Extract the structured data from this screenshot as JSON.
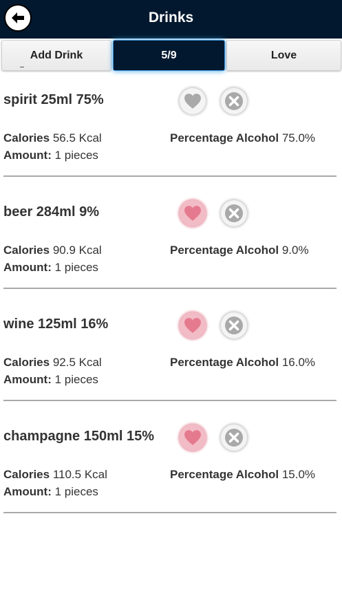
{
  "header": {
    "title": "Drinks",
    "back_icon": "arrow-left-icon"
  },
  "tabs": {
    "add_drink": "Add Drink",
    "count": "5/9",
    "love": "Love"
  },
  "labels": {
    "calories": "Calories",
    "amount": "Amount:",
    "percentage_alcohol": "Percentage Alcohol"
  },
  "colors": {
    "header_bg": "#02182e",
    "heart_active": "#e57a8e",
    "heart_inactive": "#a9a9a9",
    "delete_icon": "#a9a9a9"
  },
  "drinks": [
    {
      "name": "spirit 25ml 75%",
      "calories": "56.5 Kcal",
      "amount": "1 pieces",
      "percentage_alcohol": "75.0%",
      "loved": false
    },
    {
      "name": "beer 284ml 9%",
      "calories": "90.9 Kcal",
      "amount": "1 pieces",
      "percentage_alcohol": "9.0%",
      "loved": true
    },
    {
      "name": "wine 125ml 16%",
      "calories": "92.5 Kcal",
      "amount": "1 pieces",
      "percentage_alcohol": "16.0%",
      "loved": true
    },
    {
      "name": "champagne 150ml 15%",
      "calories": "110.5 Kcal",
      "amount": "1 pieces",
      "percentage_alcohol": "15.0%",
      "loved": true
    }
  ]
}
